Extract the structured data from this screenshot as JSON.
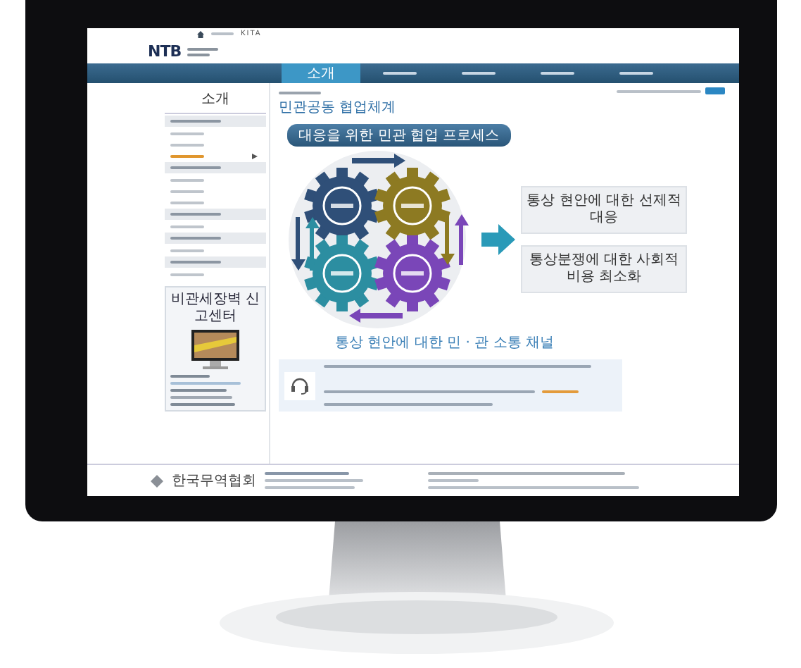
{
  "utility_bar": {
    "brand": "KITA"
  },
  "logo": {
    "text": "NTB"
  },
  "nav": [
    {
      "label": "소개",
      "selected": true
    },
    {
      "selected": false
    },
    {
      "selected": false
    },
    {
      "selected": false
    },
    {
      "selected": false
    }
  ],
  "sidebar": {
    "title": "소개",
    "items": [
      {
        "kind": "heading"
      },
      {
        "kind": "item",
        "selected": false
      },
      {
        "kind": "item",
        "selected": false
      },
      {
        "kind": "item",
        "selected": true
      },
      {
        "kind": "heading"
      },
      {
        "kind": "item",
        "selected": false
      },
      {
        "kind": "item",
        "selected": false
      },
      {
        "kind": "item",
        "selected": false
      },
      {
        "kind": "heading"
      },
      {
        "kind": "item",
        "selected": false
      },
      {
        "kind": "heading"
      },
      {
        "kind": "item",
        "selected": false
      },
      {
        "kind": "heading"
      },
      {
        "kind": "item",
        "selected": false
      }
    ],
    "report_center": {
      "title": "비관세장벽 신고센터"
    }
  },
  "content": {
    "title": "민관공동 협업체계",
    "process_label": "대응을 위한 민관 협업 프로세스",
    "outcomes": [
      "통상 현안에 대한 선제적 대응",
      "통상분쟁에 대한 사회적 비용 최소화"
    ],
    "caption": "통상 현안에 대한 민 · 관 소통 채널"
  },
  "footer": {
    "organization": "한국무역협회"
  }
}
